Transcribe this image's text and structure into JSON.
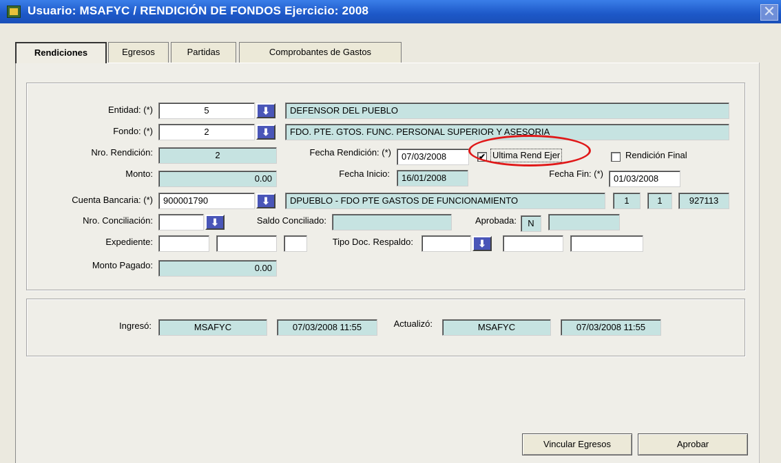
{
  "window": {
    "title": "Usuario: MSAFYC  /  RENDICIÓN DE FONDOS  Ejercicio: 2008",
    "close_glyph": "✕"
  },
  "tabs": [
    {
      "label": "Rendiciones",
      "active": true
    },
    {
      "label": "Egresos",
      "active": false
    },
    {
      "label": "Partidas",
      "active": false
    },
    {
      "label": "Comprobantes de Gastos",
      "active": false
    }
  ],
  "form": {
    "entidad": {
      "label": "Entidad: (*)",
      "code": "5",
      "desc": "DEFENSOR DEL PUEBLO"
    },
    "fondo": {
      "label": "Fondo: (*)",
      "code": "2",
      "desc": "FDO. PTE. GTOS. FUNC. PERSONAL SUPERIOR Y ASESORIA"
    },
    "nro_rendicion": {
      "label": "Nro. Rendición:",
      "value": "2"
    },
    "fecha_rendicion": {
      "label": "Fecha Rendición: (*)",
      "value": "07/03/2008"
    },
    "ultima_rend": {
      "label": "Ultima Rend Ejer",
      "checked": true,
      "mark": "✔"
    },
    "rendicion_final": {
      "label": "Rendición Final",
      "checked": false
    },
    "monto": {
      "label": "Monto:",
      "value": "0.00"
    },
    "fecha_inicio": {
      "label": "Fecha Inicio:",
      "value": "16/01/2008"
    },
    "fecha_fin": {
      "label": "Fecha Fin: (*)",
      "value": "01/03/2008"
    },
    "cuenta": {
      "label": "Cuenta Bancaria: (*)",
      "code": "900001790",
      "desc": "DPUEBLO - FDO PTE GASTOS DE FUNCIONAMIENTO",
      "f1": "1",
      "f2": "1",
      "f3": "927113"
    },
    "conciliacion": {
      "label": "Nro. Conciliación:",
      "value": ""
    },
    "saldo": {
      "label": "Saldo Conciliado:",
      "value": ""
    },
    "aprobada": {
      "label": "Aprobada:",
      "value": "N",
      "extra": ""
    },
    "expediente": {
      "label": "Expediente:",
      "v1": "",
      "v2": "",
      "v3": ""
    },
    "tipo_doc": {
      "label": "Tipo Doc. Respaldo:",
      "value": "",
      "v2": "",
      "v3": ""
    },
    "monto_pagado": {
      "label": "Monto Pagado:",
      "value": "0.00"
    }
  },
  "audit": {
    "ingreso_label": "Ingresó:",
    "ingreso_user": "MSAFYC",
    "ingreso_date": "07/03/2008 11:55",
    "actualizo_label": "Actualizó:",
    "actualizo_user": "MSAFYC",
    "actualizo_date": "07/03/2008 11:55"
  },
  "buttons": {
    "vincular": "Vincular Egresos",
    "aprobar": "Aprobar"
  },
  "icons": {
    "dropdown_glyph": "⬇"
  },
  "colors": {
    "titlebar": "#1d58c8",
    "readonly_field": "#c6e3e1",
    "dropdown_button": "#4a56b8",
    "annotation": "#e01818"
  }
}
